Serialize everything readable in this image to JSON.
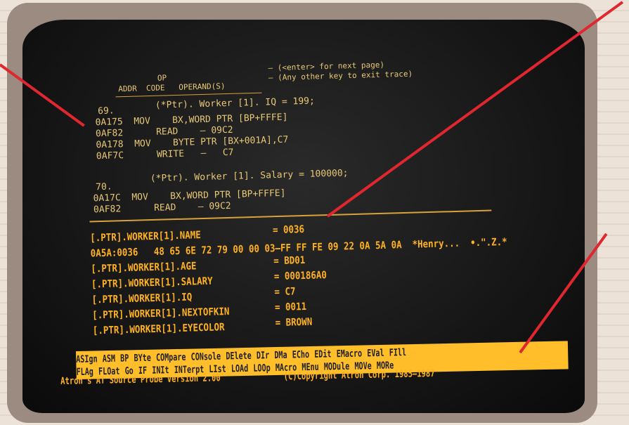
{
  "header": {
    "op": "OP",
    "columns": "ADDR  CODE   OPERAND(S)",
    "hint1": "— (<enter> for next page)",
    "hint2": "— (Any other key to exit trace)"
  },
  "trace": [
    {
      "line": "69.",
      "source": "(*Ptr). Worker [1]. IQ = 199;",
      "ops": [
        "0A175  MOV    BX,WORD PTR [BP+FFFE]",
        "0AF82      READ    – 09C2",
        "0A178  MOV    BYTE PTR [BX+001A],C7",
        "0AF7C      WRITE   –   C7"
      ]
    },
    {
      "line": "70.",
      "source": "(*Ptr). Worker [1]. Salary = 100000;",
      "ops": [
        "0A17C  MOV    BX,WORD PTR [BP+FFFE]",
        "0AF82      READ    – 09C2"
      ]
    }
  ],
  "watch": [
    {
      "name": "[.PTR].WORKER[1].NAME",
      "value": "= 0036"
    },
    {
      "dump": "0A5A:0036   48 65 6E 72 79 00 00 03–FF FF FE 09 22 0A 5A 0A  *Henry...  •.\".Z.*"
    },
    {
      "name": "[.PTR].WORKER[1].AGE",
      "value": "= BD01"
    },
    {
      "name": "[.PTR].WORKER[1].SALARY",
      "value": "= 000186A0"
    },
    {
      "name": "[.PTR].WORKER[1].IQ",
      "value": "= C7"
    },
    {
      "name": "[.PTR].WORKER[1].NEXTOFKIN",
      "value": "= 0011"
    },
    {
      "name": "[.PTR].WORKER[1].EYECOLOR",
      "value": "= BROWN"
    }
  ],
  "menu_row1": [
    "ASIgn",
    "ASM",
    "BP",
    "BYte",
    "COMpare",
    "CONsole",
    "DElete",
    "DIr",
    "DMa",
    "ECho",
    "EDit",
    "EMacro",
    "EVal",
    "FIll"
  ],
  "menu_row2": [
    "FLAg",
    "FLOat",
    "Go",
    "IF",
    "INIt",
    "INTerpt",
    "LIst",
    "LOAd",
    "LOOp",
    "MAcro",
    "MEnu",
    "MODule",
    "MOVe",
    "MORe"
  ],
  "status": {
    "version": "Atron's AT Source Probe Version 2.00",
    "copyright": "(C)Copyright Atron Corp. 1985–1987"
  },
  "colors": {
    "phosphor": "#ffb21e",
    "menu_bar": "#ffbe2a",
    "annotation_pointer": "#e0262e"
  }
}
